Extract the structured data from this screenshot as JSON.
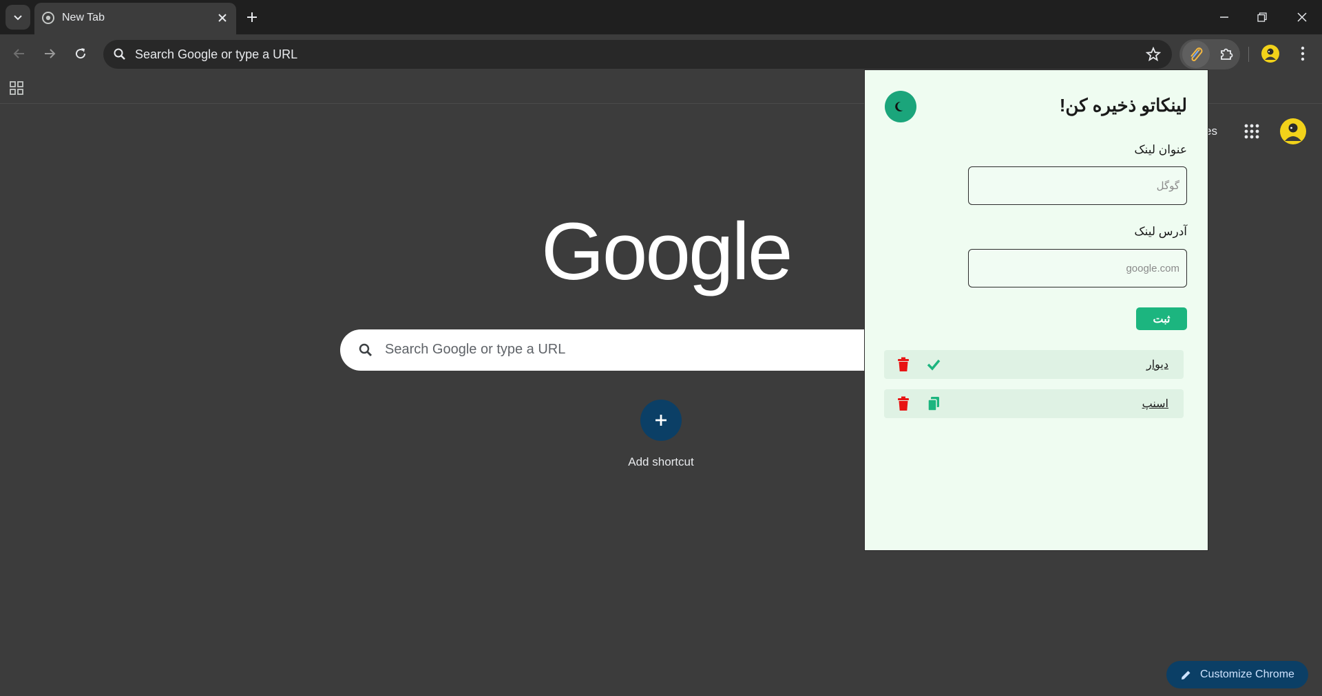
{
  "browser": {
    "tab_title": "New Tab",
    "omnibox_placeholder": "Search Google or type a URL"
  },
  "ntp": {
    "logo": "Google",
    "search_placeholder": "Search Google or type a URL",
    "add_shortcut_label": "Add shortcut",
    "customize_label": "Customize Chrome",
    "partial_link_text": "es"
  },
  "popup": {
    "title": "لینکاتو ذخیره کن!",
    "title_field_label": "عنوان لینک",
    "title_field_placeholder": "گوگل",
    "url_field_label": "آدرس لینک",
    "url_field_placeholder": "google.com",
    "submit_label": "ثبت",
    "links": [
      {
        "title": "دیوار",
        "action_icon": "check-icon"
      },
      {
        "title": "اسنپ",
        "action_icon": "copy-icon"
      }
    ]
  },
  "colors": {
    "accent_green": "#1cb57f",
    "delete_red": "#e81414",
    "popup_bg": "#effcf1"
  }
}
